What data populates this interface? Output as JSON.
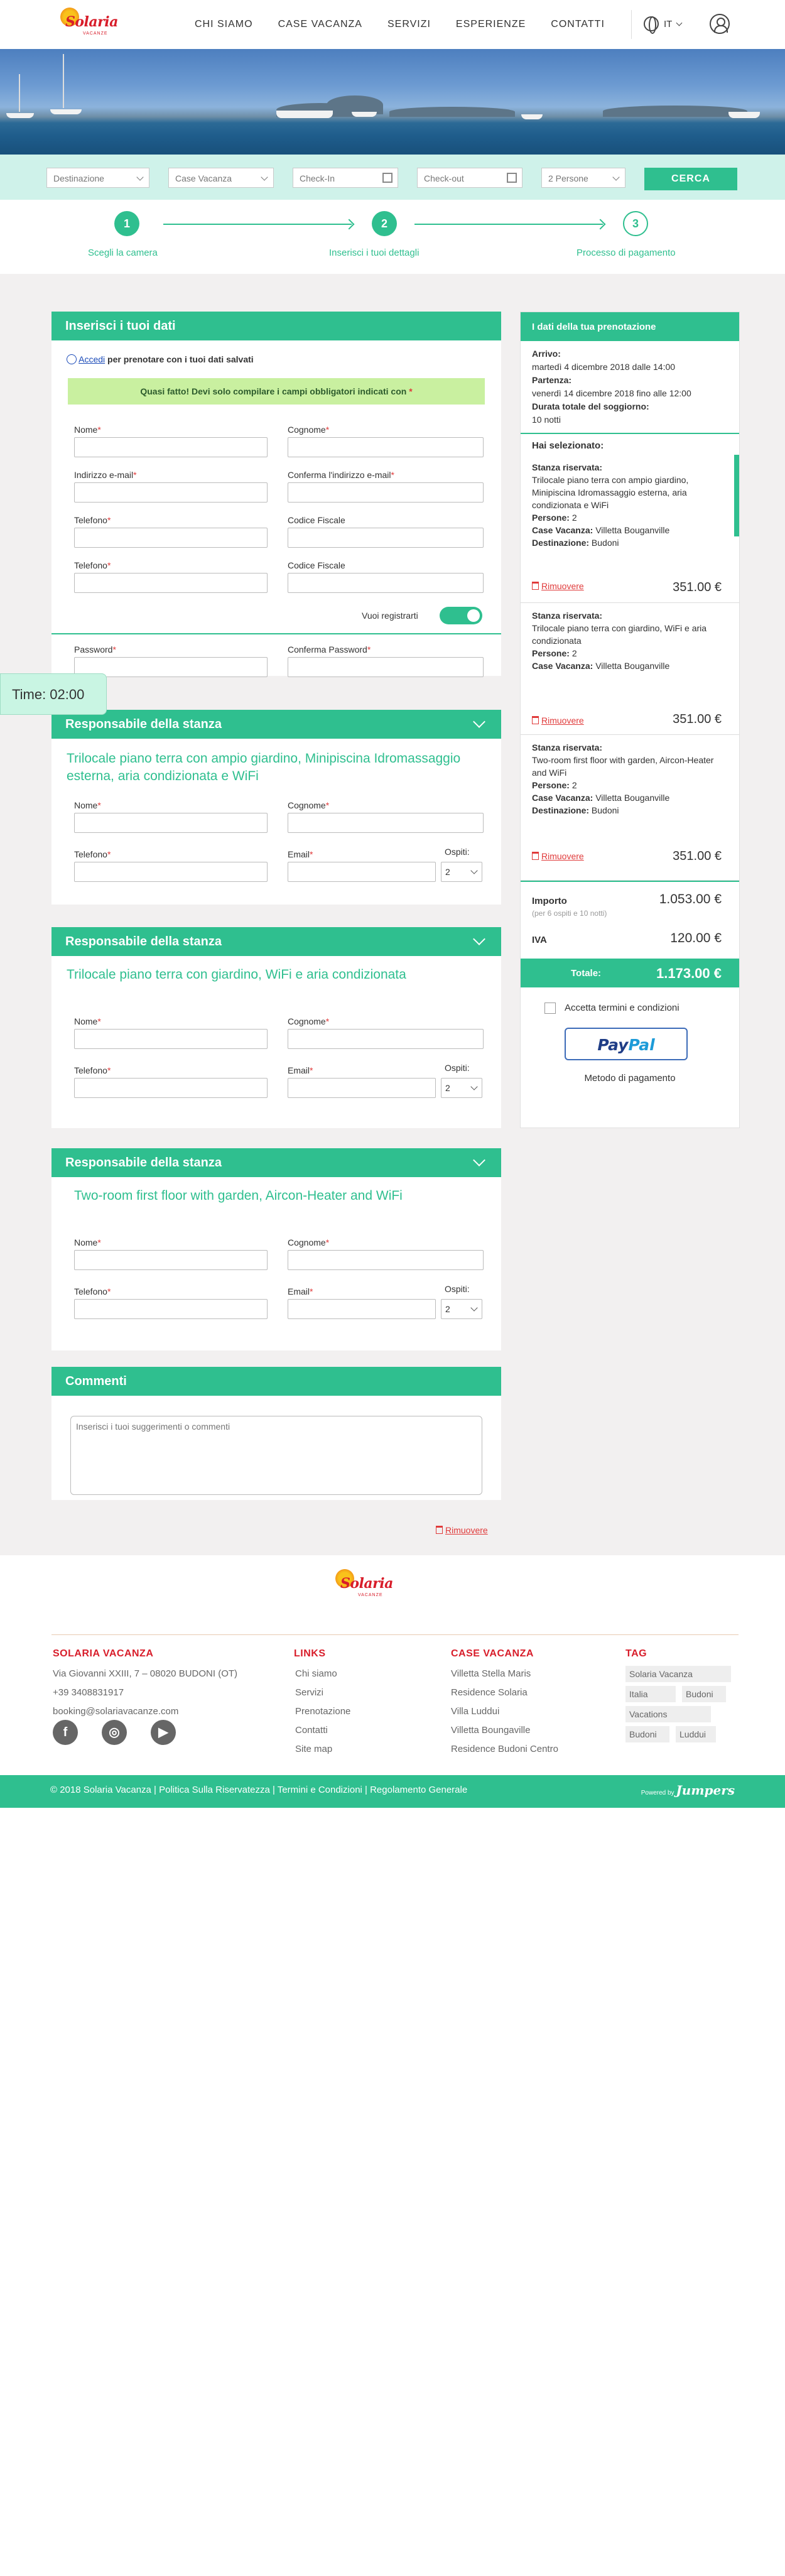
{
  "header": {
    "logo_text": "Solaria",
    "logo_sub": "VACANZE",
    "nav": [
      "CHI SIAMO",
      "CASE VACANZA",
      "SERVIZI",
      "ESPERIENZE",
      "CONTATTI"
    ],
    "lang": "IT",
    "icons": {
      "globe": "globe-icon",
      "user": "user-icon"
    }
  },
  "search": {
    "destinazione": "Destinazione",
    "case_vacanza": "Case Vacanza",
    "check_in": "Check-In",
    "check_out": "Check-out",
    "persone": "2 Persone",
    "button": "CERCA"
  },
  "steps": [
    {
      "num": "1",
      "label": "Scegli la camera"
    },
    {
      "num": "2",
      "label": "Inserisci i tuoi dettagli"
    },
    {
      "num": "3",
      "label": "Processo di pagamento"
    }
  ],
  "form": {
    "title": "Inserisci i tuoi dati",
    "login_link": "Accedi",
    "login_text": " per prenotare con i tuoi dati salvati",
    "warning": "Quasi fatto! Devi solo compilare i campi obbligatori indicati con",
    "warning_star": "*",
    "nome": "Nome",
    "cognome": "Cognome",
    "email": "Indirizzo e-mail",
    "conferma_email": "Conferma l'indirizzo e-mail",
    "telefono": "Telefono",
    "codice_fiscale": "Codice Fiscale",
    "telefono2": "Telefono",
    "codice_fiscale2": "Codice Fiscale",
    "register": "Vuoi registrarti",
    "password": "Password",
    "conferma_password": "Conferma Password"
  },
  "timer": "Time: 02:00",
  "rooms": [
    {
      "head": "Responsabile della stanza",
      "title": "Trilocale piano terra con ampio giardino, Minipiscina Idromassaggio esterna, aria condizionata e WiFi",
      "nome": "Nome",
      "cognome": "Cognome",
      "telefono": "Telefono",
      "email": "Email",
      "ospiti": "Ospiti:",
      "ospiti_val": "2"
    },
    {
      "head": "Responsabile della stanza",
      "title": "Trilocale piano terra con giardino, WiFi e aria condizionata",
      "nome": "Nome",
      "cognome": "Cognome",
      "telefono": "Telefono",
      "email": "Email",
      "ospiti": "Ospiti:",
      "ospiti_val": "2"
    },
    {
      "head": "Responsabile della stanza",
      "title": "Two-room first floor with garden, Aircon-Heater and WiFi",
      "nome": "Nome",
      "cognome": "Cognome",
      "telefono": "Telefono",
      "email": "Email",
      "ospiti": "Ospiti:",
      "ospiti_val": "2"
    }
  ],
  "comments": {
    "head": "Commenti",
    "placeholder": "Inserisci i tuoi suggerimenti o commenti",
    "remove": "Rimuovere"
  },
  "summary": {
    "head": "I dati della tua prenotazione",
    "arrivo_label": "Arrivo:",
    "arrivo": "martedì 4 dicembre 2018  dalle 14:00",
    "partenza_label": "Partenza:",
    "partenza": "venerdì 14 dicembre 2018 fino alle 12:00",
    "durata_label": "Durata totale del soggiorno:",
    "durata": "10 notti",
    "selected_head": "Hai selezionato:",
    "items": [
      {
        "label": "Stanza riservata:",
        "room": "Trilocale piano terra con ampio giardino, Minipiscina Idromassaggio esterna, aria condizionata e WiFi",
        "persone_label": "Persone:",
        "persone": "2",
        "casa_label": "Case Vacanza:",
        "casa": "Villetta Bouganville",
        "dest_label": "Destinazione:",
        "dest": "Budoni",
        "remove": "Rimuovere",
        "price": "351.00 €"
      },
      {
        "label": "Stanza riservata:",
        "room": "Trilocale piano terra con giardino, WiFi e aria condizionata",
        "persone_label": "Persone:",
        "persone": "2",
        "casa_label": "Case Vacanza:",
        "casa": "Villetta Bouganville",
        "dest_label": "Destinazione:",
        "dest": "Budoni",
        "remove": "Rimuovere",
        "price": "351.00 €"
      },
      {
        "label": "Stanza riservata:",
        "room": "Two-room first floor with garden, Aircon-Heater and WiFi",
        "persone_label": "Persone:",
        "persone": "2",
        "casa_label": "Case Vacanza:",
        "casa": "Villetta Bouganville",
        "dest_label": "Destinazione:",
        "dest": "Budoni",
        "remove": "Rimuovere",
        "price": "351.00 €"
      }
    ],
    "importo_label": "Importo",
    "importo": "1.053.00 €",
    "importo_note": "(per 6 ospiti e 10 notti)",
    "iva_label": "IVA",
    "iva": "120.00 €",
    "totale_label": "Totale:",
    "totale": "1.173.00 €",
    "terms": "Accetta termini e condizioni",
    "paypal_1": "Pay",
    "paypal_2": "Pal",
    "payment_method": "Metodo di pagamento"
  },
  "footer": {
    "logo_text": "Solaria",
    "logo_sub": "VACANZE",
    "col1_title": "SOLARIA VACANZA",
    "address": "Via Giovanni XXIII, 7 – 08020 BUDONI (OT)",
    "phone": "+39 3408831917",
    "email": "booking@solariavacanze.com",
    "col2_title": "LINKS",
    "links": [
      "Chi siamo",
      "Servizi",
      "Prenotazione",
      "Contatti",
      "Site map"
    ],
    "col3_title": "CASE VACANZA",
    "houses": [
      "Villetta Stella Maris",
      "Residence Solaria",
      "Villa Luddui",
      "Villetta Boungaville",
      "Residence Budoni Centro"
    ],
    "col4_title": "TAG",
    "tags": [
      "Solaria Vacanza",
      "Italia",
      "Budoni",
      "Vacations",
      "Budoni",
      "Luddui"
    ],
    "copyright": "© 2018 Solaria Vacanza  |  Politica Sulla Riservatezza  |  Termini e Condizioni  |  Regolamento Generale",
    "powered_by": "Powered by",
    "powered_brand": "Jumpers"
  }
}
